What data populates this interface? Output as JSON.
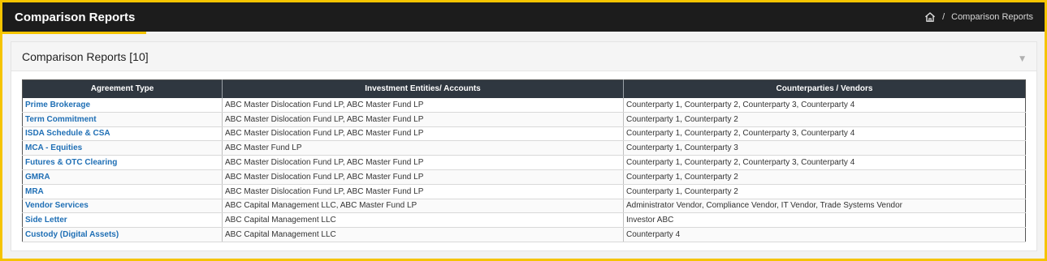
{
  "header": {
    "title": "Comparison Reports",
    "breadcrumb": {
      "separator": "/",
      "current": "Comparison Reports"
    }
  },
  "card": {
    "title": "Comparison Reports [10]"
  },
  "table": {
    "columns": [
      "Agreement Type",
      "Investment Entities/ Accounts",
      "Counterparties / Vendors"
    ],
    "rows": [
      [
        "Prime Brokerage",
        "ABC Master Dislocation Fund LP, ABC Master Fund LP",
        "Counterparty 1, Counterparty 2, Counterparty 3, Counterparty 4"
      ],
      [
        "Term Commitment",
        "ABC Master Dislocation Fund LP, ABC Master Fund LP",
        "Counterparty 1, Counterparty 2"
      ],
      [
        "ISDA Schedule & CSA",
        "ABC Master Dislocation Fund LP, ABC Master Fund LP",
        "Counterparty 1, Counterparty 2, Counterparty 3, Counterparty 4"
      ],
      [
        "MCA - Equities",
        "ABC Master Fund LP",
        "Counterparty 1, Counterparty 3"
      ],
      [
        "Futures & OTC Clearing",
        "ABC Master Dislocation Fund LP, ABC Master Fund LP",
        "Counterparty 1, Counterparty 2, Counterparty 3, Counterparty 4"
      ],
      [
        "GMRA",
        "ABC Master Dislocation Fund LP, ABC Master Fund LP",
        "Counterparty 1, Counterparty 2"
      ],
      [
        "MRA",
        "ABC Master Dislocation Fund LP, ABC Master Fund LP",
        "Counterparty 1, Counterparty 2"
      ],
      [
        "Vendor Services",
        "ABC Capital Management LLC, ABC Master Fund LP",
        "Administrator Vendor, Compliance Vendor, IT Vendor, Trade Systems Vendor"
      ],
      [
        "Side Letter",
        "ABC Capital Management LLC",
        "Investor ABC"
      ],
      [
        "Custody (Digital Assets)",
        "ABC Capital Management LLC",
        "Counterparty 4"
      ]
    ]
  },
  "icons": {
    "home": "home-icon",
    "collapse": "chevron-down-icon"
  },
  "colors": {
    "topbar": "#1c1c1c",
    "accent": "#f5c400",
    "link": "#1f6fb5",
    "table_header": "#2f3740"
  }
}
